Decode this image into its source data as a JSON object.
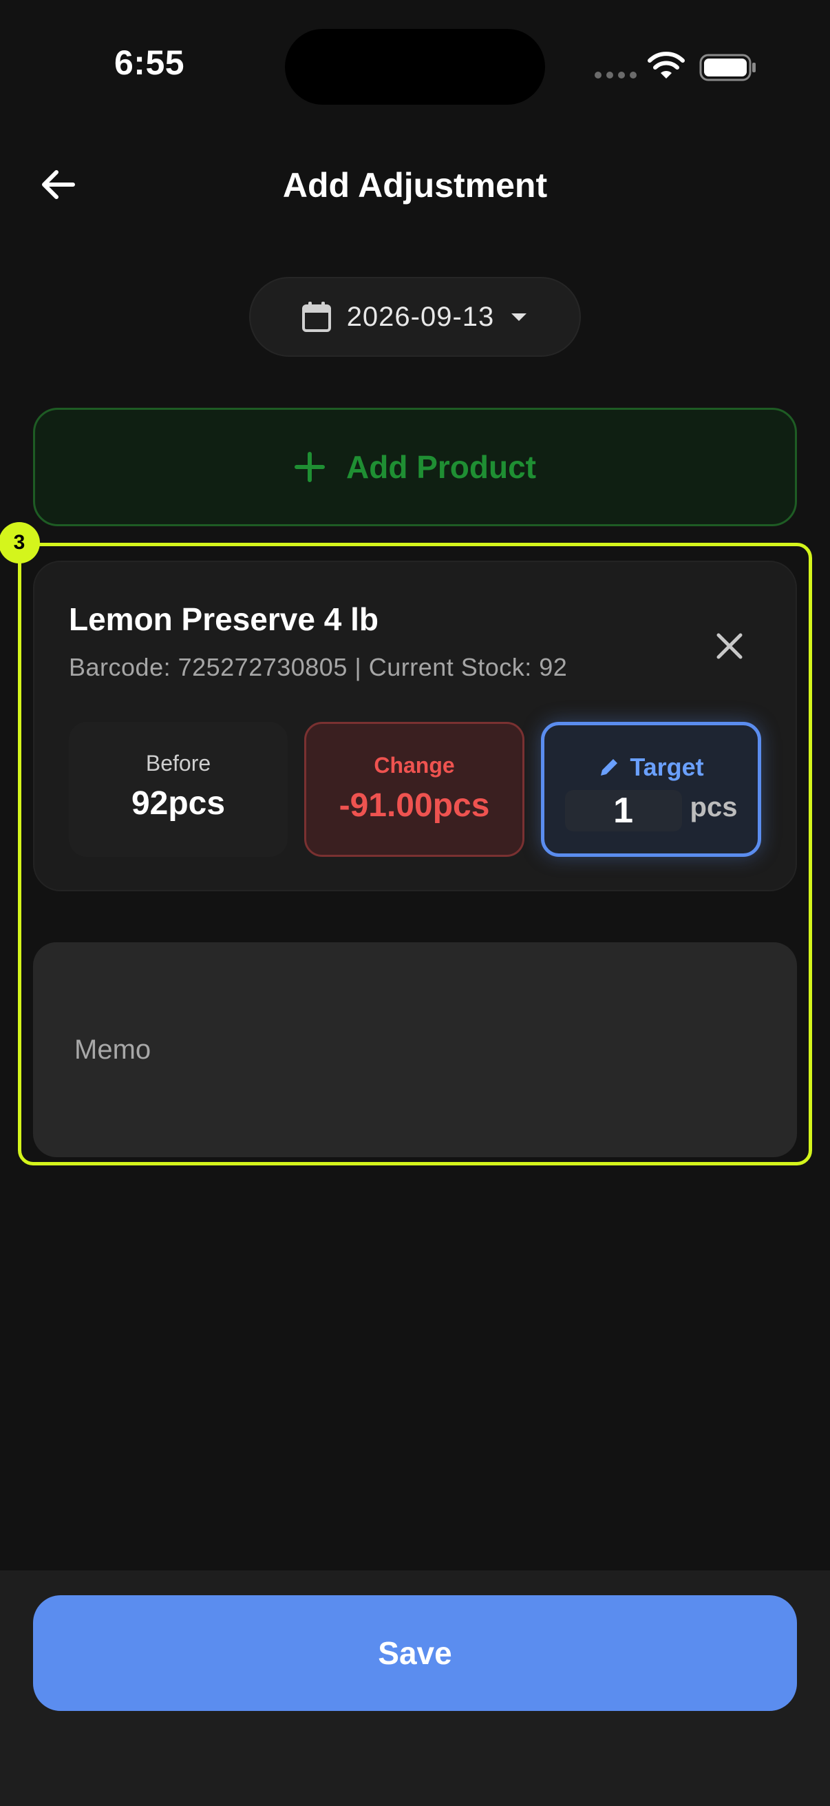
{
  "status_bar": {
    "time": "6:55"
  },
  "header": {
    "title": "Add Adjustment"
  },
  "date_selector": {
    "value": "2026-09-13"
  },
  "add_product": {
    "label": "Add Product"
  },
  "highlight": {
    "badge": "3"
  },
  "product": {
    "name": "Lemon Preserve 4 lb",
    "meta": "Barcode: 725272730805 | Current Stock: 92",
    "before": {
      "label": "Before",
      "value": "92pcs"
    },
    "change": {
      "label": "Change",
      "value": "-91.00pcs"
    },
    "target": {
      "label": "Target",
      "value": "1",
      "unit": "pcs"
    }
  },
  "memo": {
    "placeholder": "Memo"
  },
  "save": {
    "label": "Save"
  },
  "colors": {
    "background": "#121212",
    "accent_blue": "#5b8def",
    "add_green": "#1f8f33",
    "change_red": "#ef5350",
    "highlight": "#d4f51c"
  }
}
